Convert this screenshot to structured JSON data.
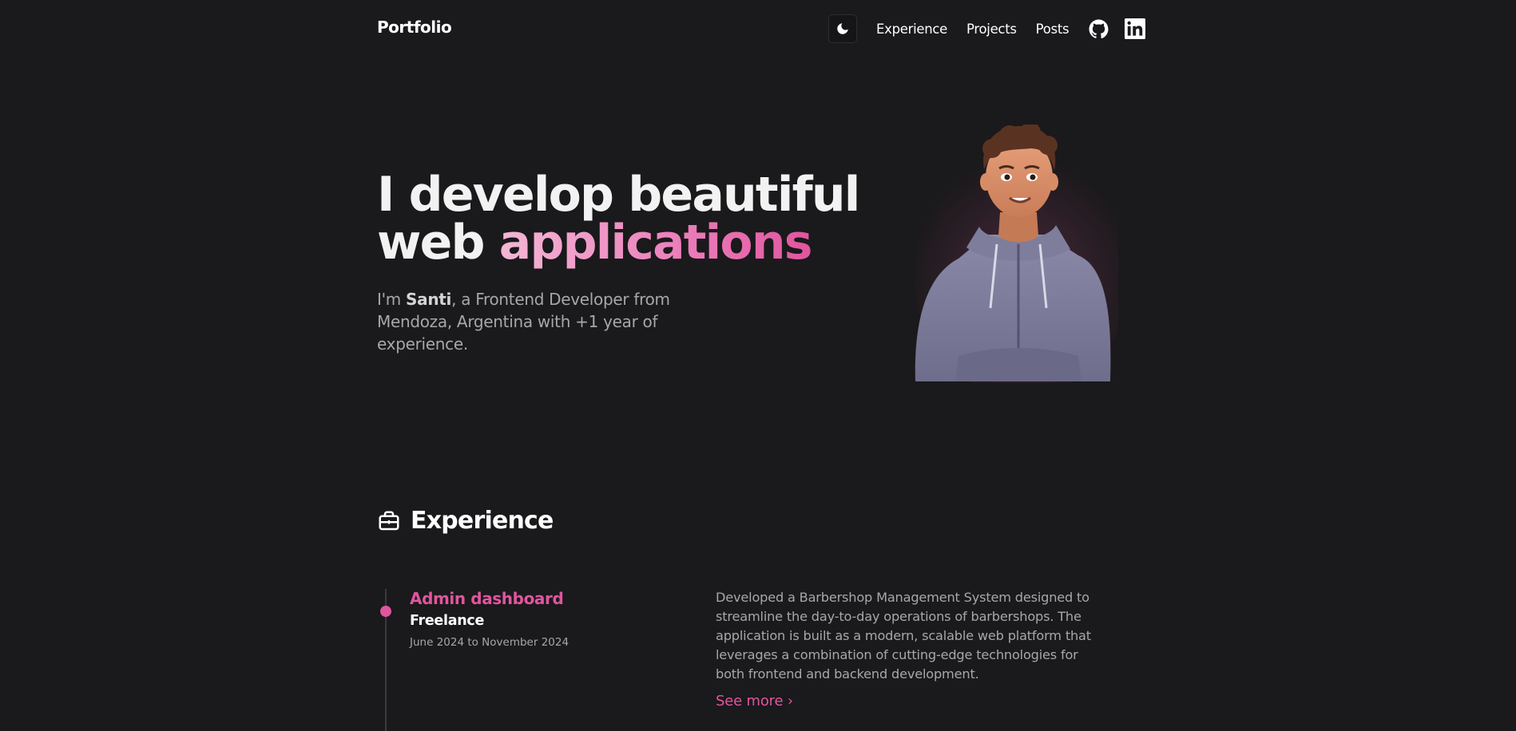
{
  "header": {
    "brand": "Portfolio",
    "theme_toggle_icon": "moon-icon",
    "nav": [
      {
        "label": "Experience"
      },
      {
        "label": "Projects"
      },
      {
        "label": "Posts"
      }
    ],
    "social": [
      {
        "icon": "github-icon"
      },
      {
        "icon": "linkedin-icon"
      }
    ]
  },
  "hero": {
    "title_line1": "I develop beautiful",
    "title_line2_plain": "web",
    "title_line2_accent": "applications",
    "subtitle_prefix": "I'm",
    "subtitle_name": "Santi",
    "subtitle_rest": ", a Frontend Developer from Mendoza, Argentina with +1 year of experience.",
    "avatar_icon": "developer-avatar-illustration"
  },
  "experience": {
    "section_icon": "briefcase-icon",
    "title": "Experience",
    "items": [
      {
        "title": "Admin dashboard",
        "company": "Freelance",
        "dates": "June 2024 to November 2024",
        "description": "Developed a Barbershop Management System designed to streamline the day-to-day operations of barbershops. The application is built as a modern, scalable web platform that leverages a combination of cutting-edge technologies for both frontend and backend development.",
        "link_label": "See more ›"
      }
    ]
  },
  "colors": {
    "background": "#1a191b",
    "accent": "#e0559e",
    "text": "#f2f2f2",
    "muted": "#a8a6ab"
  }
}
